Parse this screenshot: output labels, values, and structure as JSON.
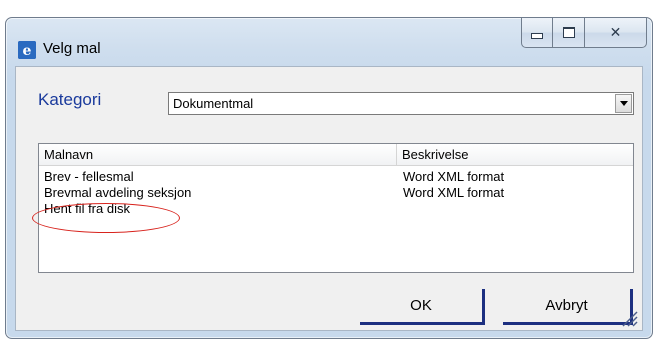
{
  "window": {
    "title": "Velg mal"
  },
  "caption_buttons": {
    "minimize": "minimize-icon",
    "maximize": "maximize-icon",
    "close": "close-icon"
  },
  "kategori": {
    "label": "Kategori",
    "selected": "Dokumentmal"
  },
  "list": {
    "columns": [
      "Malnavn",
      "Beskrivelse"
    ],
    "rows": [
      {
        "name": "Brev - fellesmal",
        "description": "Word XML format"
      },
      {
        "name": "Brevmal avdeling seksjon",
        "description": "Word XML format"
      },
      {
        "name": "Hent fil fra disk",
        "description": ""
      }
    ]
  },
  "buttons": {
    "ok": "OK",
    "cancel": "Avbryt"
  },
  "colors": {
    "label_blue": "#1a3a9c",
    "button_border": "#1c2f80",
    "annotation_red": "#d8241e"
  }
}
